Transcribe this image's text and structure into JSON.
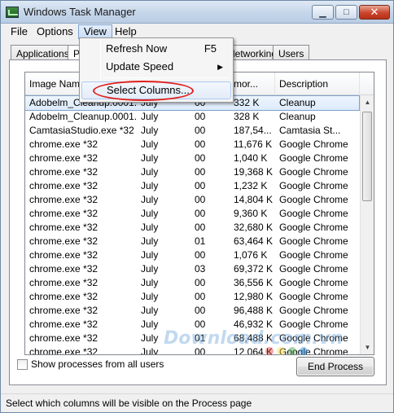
{
  "window": {
    "title": "Windows Task Manager"
  },
  "menu": [
    "File",
    "Options",
    "View",
    "Help"
  ],
  "tabs": [
    "Applications",
    "P",
    "Networking",
    "Users"
  ],
  "view_menu": {
    "items": [
      {
        "label": "Refresh Now",
        "shortcut": "F5"
      },
      {
        "label": "Update Speed",
        "submenu": "▶"
      },
      {
        "label": "Select Columns..."
      }
    ]
  },
  "columns": [
    "Image Name",
    "",
    "",
    "mor...",
    "Description"
  ],
  "rows": [
    [
      "Adobelm_Cleanup.0001...",
      "July",
      "00",
      "332 K",
      "Cleanup"
    ],
    [
      "Adobelm_Cleanup.0001...",
      "July",
      "00",
      "328 K",
      "Cleanup"
    ],
    [
      "CamtasiaStudio.exe *32",
      "July",
      "00",
      "187,54...",
      "Camtasia St..."
    ],
    [
      "chrome.exe *32",
      "July",
      "00",
      "11,676 K",
      "Google Chrome"
    ],
    [
      "chrome.exe *32",
      "July",
      "00",
      "1,040 K",
      "Google Chrome"
    ],
    [
      "chrome.exe *32",
      "July",
      "00",
      "19,368 K",
      "Google Chrome"
    ],
    [
      "chrome.exe *32",
      "July",
      "00",
      "1,232 K",
      "Google Chrome"
    ],
    [
      "chrome.exe *32",
      "July",
      "00",
      "14,804 K",
      "Google Chrome"
    ],
    [
      "chrome.exe *32",
      "July",
      "00",
      "9,360 K",
      "Google Chrome"
    ],
    [
      "chrome.exe *32",
      "July",
      "00",
      "32,680 K",
      "Google Chrome"
    ],
    [
      "chrome.exe *32",
      "July",
      "01",
      "63,464 K",
      "Google Chrome"
    ],
    [
      "chrome.exe *32",
      "July",
      "00",
      "1,076 K",
      "Google Chrome"
    ],
    [
      "chrome.exe *32",
      "July",
      "03",
      "69,372 K",
      "Google Chrome"
    ],
    [
      "chrome.exe *32",
      "July",
      "00",
      "36,556 K",
      "Google Chrome"
    ],
    [
      "chrome.exe *32",
      "July",
      "00",
      "12,980 K",
      "Google Chrome"
    ],
    [
      "chrome.exe *32",
      "July",
      "00",
      "96,488 K",
      "Google Chrome"
    ],
    [
      "chrome.exe *32",
      "July",
      "00",
      "46,932 K",
      "Google Chrome"
    ],
    [
      "chrome.exe *32",
      "July",
      "01",
      "68,488 K",
      "Google Chrome"
    ],
    [
      "chrome.exe *32",
      "July",
      "00",
      "12,064 K",
      "Google Chrome"
    ]
  ],
  "show_all_label": "Show processes from all users",
  "end_process_label": "End Process",
  "status": "Select which columns will be visible on the Process page",
  "watermark": "Download.com.vn"
}
